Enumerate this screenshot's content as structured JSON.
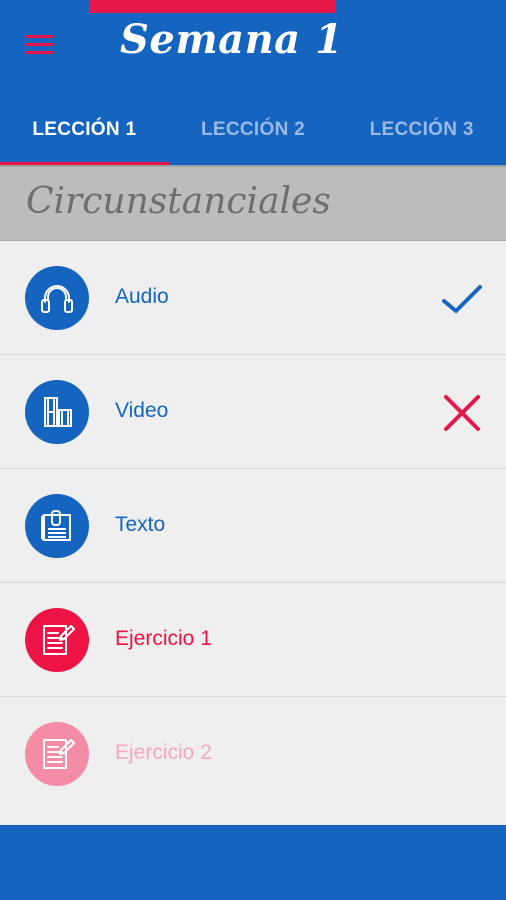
{
  "colors": {
    "primary": "#1565c0",
    "accent": "#e8174a",
    "exercise_red": "#ee1345",
    "exercise_disabled": "#f48ca5",
    "list_background": "#efefef",
    "section_band": "#bcbcbc"
  },
  "header": {
    "menu_icon": "hamburger-menu-icon",
    "title": "Semana 1"
  },
  "tabs": [
    {
      "label": "LECCIÓN 1",
      "active": true
    },
    {
      "label": "LECCIÓN 2",
      "active": false
    },
    {
      "label": "LECCIÓN 3",
      "active": false
    }
  ],
  "section": {
    "title": "Circunstanciales"
  },
  "items": [
    {
      "label": "Audio",
      "icon": "headphones-icon",
      "status": "completed",
      "status_icon": "checkmark-icon"
    },
    {
      "label": "Video",
      "icon": "film-strip-icon",
      "status": "failed",
      "status_icon": "cross-icon"
    },
    {
      "label": "Texto",
      "icon": "document-icon",
      "status": "none"
    },
    {
      "label": "Ejercicio 1",
      "icon": "exercise-edit-icon",
      "status": "none"
    },
    {
      "label": "Ejercicio 2",
      "icon": "exercise-edit-icon",
      "status": "disabled"
    }
  ]
}
